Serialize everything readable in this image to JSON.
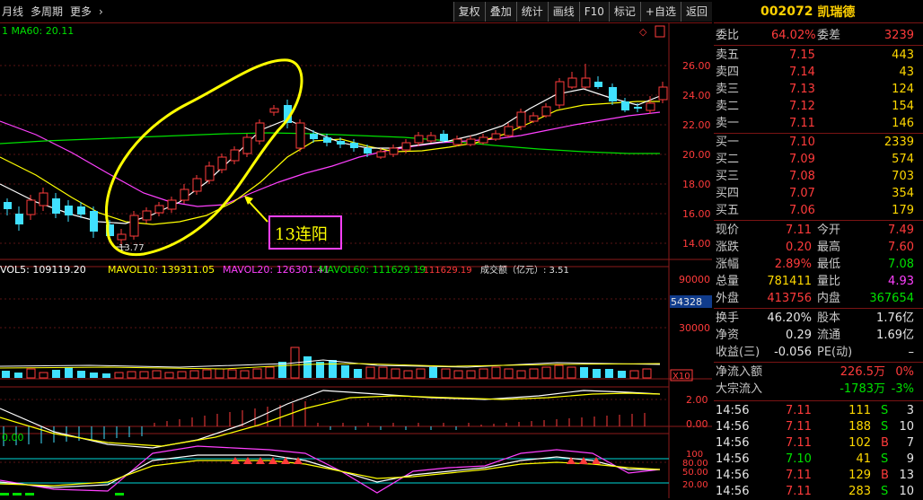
{
  "toolbar": {
    "left_items": [
      "月线",
      "多周期",
      "更多"
    ],
    "more_arrow": "›",
    "buttons": [
      "复权",
      "叠加",
      "统计",
      "画线",
      "F10",
      "标记",
      "+自选",
      "返回"
    ]
  },
  "chart": {
    "ma_label": "1  MA60: 20.11",
    "price_ticks": [
      "26.00",
      "24.00",
      "22.00",
      "20.00",
      "18.00",
      "16.00",
      "14.00"
    ],
    "low_label": "13.77",
    "annotation": "13连阳",
    "vol_labels": {
      "vol5": "VOL5: 109119.20",
      "mavol10": "MAVOL10: 139311.05",
      "mavol20": "MAVOL20: 126301.41",
      "mavol60": "MAVOL60: 111629.19",
      "extra": ": 111629.19",
      "amount": "成交额（亿元）: 3.51"
    },
    "vol_ticks": [
      "90000",
      "54328",
      "30000"
    ],
    "vol_scale": "X10",
    "macd_ticks": [
      "2.00",
      "0.00"
    ],
    "kdj_label": "0.00",
    "kdj_ticks": [
      "100",
      "80.00",
      "50.00",
      "20.00"
    ],
    "colors": {
      "up": "#ff3b3b",
      "down": "#40e0ff",
      "ma5": "#ffffff",
      "ma10": "#ffff00",
      "ma20": "#ff40ff",
      "ma60": "#00e000",
      "annot": "#ffff00",
      "box": "#ff40ff"
    }
  },
  "quote": {
    "code": "002072",
    "name": "凯瑞德",
    "webi": {
      "label": "委比",
      "value": "64.02%",
      "label2": "委差",
      "value2": "3239"
    },
    "asks": [
      {
        "label": "卖五",
        "price": "7.15",
        "vol": "443"
      },
      {
        "label": "卖四",
        "price": "7.14",
        "vol": "43"
      },
      {
        "label": "卖三",
        "price": "7.13",
        "vol": "124"
      },
      {
        "label": "卖二",
        "price": "7.12",
        "vol": "154"
      },
      {
        "label": "卖一",
        "price": "7.11",
        "vol": "146"
      }
    ],
    "bids": [
      {
        "label": "买一",
        "price": "7.10",
        "vol": "2339"
      },
      {
        "label": "买二",
        "price": "7.09",
        "vol": "574"
      },
      {
        "label": "买三",
        "price": "7.08",
        "vol": "703"
      },
      {
        "label": "买四",
        "price": "7.07",
        "vol": "354"
      },
      {
        "label": "买五",
        "price": "7.06",
        "vol": "179"
      }
    ],
    "stats": [
      {
        "l1": "现价",
        "v1": "7.11",
        "l2": "今开",
        "v2": "7.49"
      },
      {
        "l1": "涨跌",
        "v1": "0.20",
        "l2": "最高",
        "v2": "7.60"
      },
      {
        "l1": "涨幅",
        "v1": "2.89%",
        "l2": "最低",
        "v2": "7.08"
      },
      {
        "l1": "总量",
        "v1": "781411",
        "l2": "量比",
        "v2": "4.93"
      },
      {
        "l1": "外盘",
        "v1": "413756",
        "l2": "内盘",
        "v2": "367654"
      }
    ],
    "stats2": [
      {
        "l1": "换手",
        "v1": "46.20%",
        "l2": "股本",
        "v2": "1.76亿"
      },
      {
        "l1": "净资",
        "v1": "0.29",
        "l2": "流通",
        "v2": "1.69亿"
      },
      {
        "l1": "收益(三)",
        "v1": "-0.056",
        "l2": "PE(动)",
        "v2": "–"
      }
    ],
    "flows": [
      {
        "label": "净流入额",
        "value": "226.5万",
        "pct": "0%"
      },
      {
        "label": "大宗流入",
        "value": "-1783万",
        "pct": "-3%"
      }
    ],
    "ticks": [
      {
        "time": "14:56",
        "price": "7.11",
        "vol": "111",
        "bs": "S",
        "n": "3"
      },
      {
        "time": "14:56",
        "price": "7.11",
        "vol": "188",
        "bs": "S",
        "n": "10"
      },
      {
        "time": "14:56",
        "price": "7.11",
        "vol": "102",
        "bs": "B",
        "n": "7"
      },
      {
        "time": "14:56",
        "price": "7.10",
        "vol": "41",
        "bs": "S",
        "n": "9"
      },
      {
        "time": "14:56",
        "price": "7.11",
        "vol": "129",
        "bs": "B",
        "n": "13"
      },
      {
        "time": "14:56",
        "price": "7.11",
        "vol": "283",
        "bs": "S",
        "n": "10"
      }
    ]
  }
}
